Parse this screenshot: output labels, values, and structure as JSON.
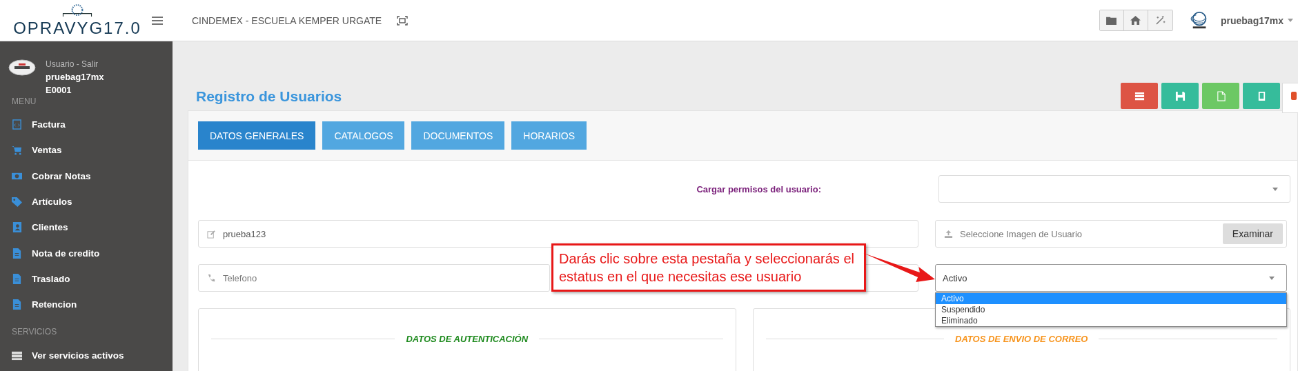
{
  "header": {
    "logo": "OPRAVYG17.0",
    "company": "CINDEMEX - ESCUELA KEMPER URGATE",
    "user": "pruebag17mx"
  },
  "sidebar": {
    "user_links": "Usuario - Salir",
    "username": "pruebag17mx",
    "code": "E0001",
    "sections": [
      {
        "title": "MENU",
        "items": [
          {
            "label": "Factura",
            "kind": "invoice"
          },
          {
            "label": "Ventas",
            "kind": "cart"
          },
          {
            "label": "Cobrar Notas",
            "kind": "money"
          },
          {
            "label": "Artículos",
            "kind": "tag"
          },
          {
            "label": "Clientes",
            "kind": "book"
          },
          {
            "label": "Nota de credito",
            "kind": "doc"
          },
          {
            "label": "Traslado",
            "kind": "doc"
          },
          {
            "label": "Retencion",
            "kind": "doc"
          }
        ]
      },
      {
        "title": "SERVICIOS",
        "items": [
          {
            "label": "Ver servicios activos",
            "kind": "server"
          }
        ]
      }
    ]
  },
  "page_title": "Registro de Usuarios",
  "action_buttons": [
    {
      "kind": "list",
      "color": "#dd5444"
    },
    {
      "kind": "save",
      "color": "#36bc9b"
    },
    {
      "kind": "file",
      "color": "#6cc864"
    },
    {
      "kind": "tablet",
      "color": "#36bc9b"
    }
  ],
  "tabs": [
    {
      "label": "DATOS GENERALES",
      "selected": true
    },
    {
      "label": "CATALOGOS",
      "selected": false
    },
    {
      "label": "DOCUMENTOS",
      "selected": false
    },
    {
      "label": "HORARIOS",
      "selected": false
    }
  ],
  "permissions_label": "Cargar permisos del usuario:",
  "username_field": {
    "value": "prueba123"
  },
  "image_field": {
    "placeholder": "Seleccione Imagen de Usuario",
    "button": "Examinar"
  },
  "phone_field": {
    "placeholder": "Telefono"
  },
  "status_select": {
    "value": "Activo",
    "options": [
      {
        "label": "Activo",
        "selected": true
      },
      {
        "label": "Suspendido",
        "selected": false
      },
      {
        "label": "Eliminado",
        "selected": false
      }
    ]
  },
  "sections": [
    {
      "title": "DATOS DE AUTENTICACIÓN",
      "color": "#1e8a1e"
    },
    {
      "title": "DATOS DE ENVIO DE CORREO",
      "color": "#f7941d"
    }
  ],
  "callout": "Darás clic sobre esta pestaña y seleccionarás el estatus en el que necesitas ese usuario"
}
